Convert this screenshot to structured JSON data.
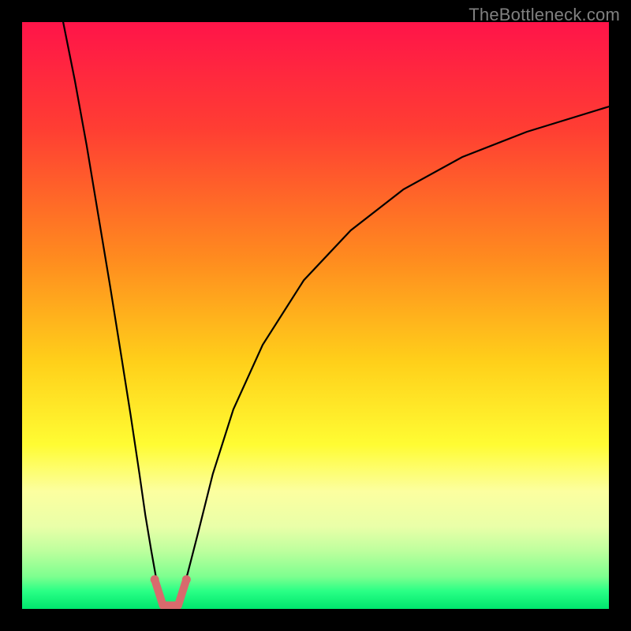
{
  "watermark": {
    "text": "TheBottleneck.com"
  },
  "chart_data": {
    "type": "line",
    "title": "",
    "xlabel": "",
    "ylabel": "",
    "xlim": [
      0,
      100
    ],
    "ylim": [
      0,
      100
    ],
    "grid": false,
    "legend": false,
    "background_gradient_stops": [
      {
        "offset": 0.0,
        "color": "#ff1449"
      },
      {
        "offset": 0.18,
        "color": "#ff3d33"
      },
      {
        "offset": 0.4,
        "color": "#ff8a1f"
      },
      {
        "offset": 0.58,
        "color": "#ffd01a"
      },
      {
        "offset": 0.72,
        "color": "#fffc33"
      },
      {
        "offset": 0.8,
        "color": "#fcffa0"
      },
      {
        "offset": 0.86,
        "color": "#e9ffa8"
      },
      {
        "offset": 0.9,
        "color": "#bfff9e"
      },
      {
        "offset": 0.945,
        "color": "#7dff8f"
      },
      {
        "offset": 0.97,
        "color": "#29ff85"
      },
      {
        "offset": 1.0,
        "color": "#00e66d"
      }
    ],
    "series": [
      {
        "name": "left-branch",
        "color": "#000000",
        "stroke_width": 2.2,
        "x": [
          7.0,
          9.0,
          11.0,
          13.0,
          15.0,
          17.0,
          18.5,
          20.0,
          21.0,
          22.0,
          22.8,
          23.4
        ],
        "values": [
          100,
          90.0,
          79.0,
          67.0,
          55.0,
          42.5,
          33.0,
          23.0,
          16.0,
          10.0,
          5.5,
          2.8
        ]
      },
      {
        "name": "right-branch",
        "color": "#000000",
        "stroke_width": 2.2,
        "x": [
          27.2,
          28.2,
          30.0,
          32.5,
          36.0,
          41.0,
          48.0,
          56.0,
          65.0,
          75.0,
          86.0,
          100.0
        ],
        "values": [
          2.8,
          6.0,
          13.0,
          23.0,
          34.0,
          45.0,
          56.0,
          64.5,
          71.5,
          77.0,
          81.3,
          85.6
        ]
      },
      {
        "name": "u-band",
        "type": "overlay-band",
        "color": "#d86a6d",
        "stroke_width": 10,
        "linecap": "round",
        "segments": [
          {
            "x": [
              22.6,
              24.0
            ],
            "values": [
              5.0,
              0.6
            ]
          },
          {
            "x": [
              24.0,
              26.6
            ],
            "values": [
              0.6,
              0.6
            ]
          },
          {
            "x": [
              26.6,
              28.0
            ],
            "values": [
              0.6,
              5.0
            ]
          }
        ],
        "endpoints_radius": 5.5
      }
    ],
    "annotations": []
  }
}
